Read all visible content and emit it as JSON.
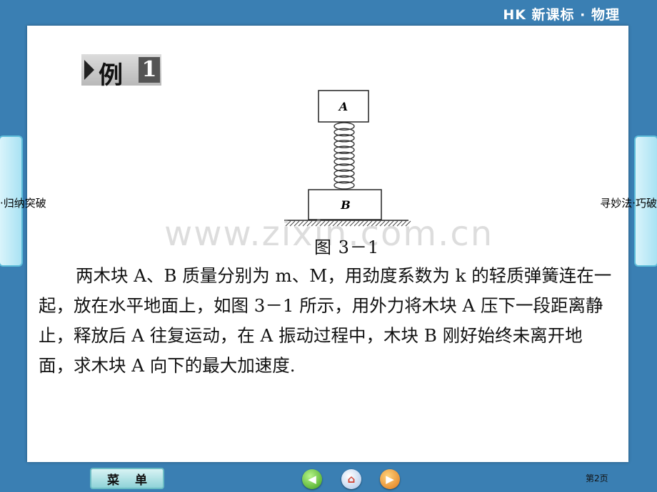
{
  "header": {
    "title": "HK 新课标 · 物理"
  },
  "side_tabs": {
    "left_label": "·归纳突破",
    "right_label": "寻妙法·巧破"
  },
  "example": {
    "word": "例",
    "number": "1"
  },
  "figure": {
    "block_a_label": "A",
    "block_b_label": "B",
    "caption": "图 3－1"
  },
  "watermark": "www.zixin.com.cn",
  "problem": {
    "text": "两木块 A、B 质量分别为 m、M，用劲度系数为 k 的轻质弹簧连在一起，放在水平地面上，如图 3－1 所示，用外力将木块 A 压下一段距离静止，释放后 A 往复运动，在 A 振动过程中，木块 B 刚好始终未离开地面，求木块 A 向下的最大加速度."
  },
  "footer": {
    "menu_label_left": "菜",
    "menu_label_right": "单",
    "home_glyph": "⌂",
    "prev_glyph": "◀",
    "next_glyph": "▶",
    "page_label": "第2页"
  },
  "colors": {
    "background": "#3a7fb3",
    "panel": "#ffffff",
    "tab": "#a9e2f3"
  }
}
